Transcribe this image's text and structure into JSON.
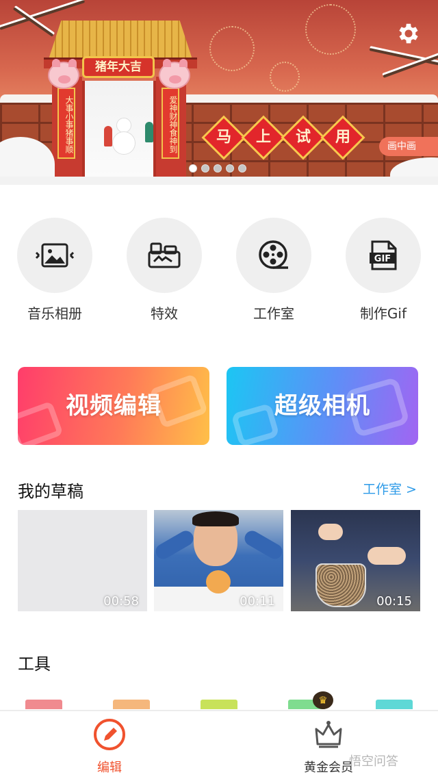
{
  "banner": {
    "gate_sign": "猪年大吉",
    "couplet_left": "大事小事猪事顺",
    "couplet_right": "爱神财神食神到",
    "try_chars": [
      "马",
      "上",
      "试",
      "用"
    ],
    "pip_label": "画中画",
    "slide_count": 5,
    "active_slide": 0,
    "settings_icon": "gear-icon"
  },
  "quick_actions": [
    {
      "label": "音乐相册",
      "icon": "photo-album-icon"
    },
    {
      "label": "特效",
      "icon": "effects-icon"
    },
    {
      "label": "工作室",
      "icon": "film-reel-icon"
    },
    {
      "label": "制作Gif",
      "icon": "gif-icon"
    }
  ],
  "feature_cards": {
    "video_edit": {
      "label": "视频编辑",
      "icon": "video-camera-icon"
    },
    "super_camera": {
      "label": "超级相机",
      "icon": "camera-icon"
    }
  },
  "drafts": {
    "title": "我的草稿",
    "link": "工作室 >",
    "items": [
      {
        "duration": "00:58"
      },
      {
        "duration": "00:11"
      },
      {
        "duration": "00:15"
      }
    ]
  },
  "tools": {
    "title": "工具"
  },
  "bottom_nav": {
    "edit_label": "编辑",
    "vip_label": "黄金会员"
  },
  "watermark": "悟空问答",
  "colors": {
    "accent": "#f0522e",
    "link": "#2e9be8"
  }
}
